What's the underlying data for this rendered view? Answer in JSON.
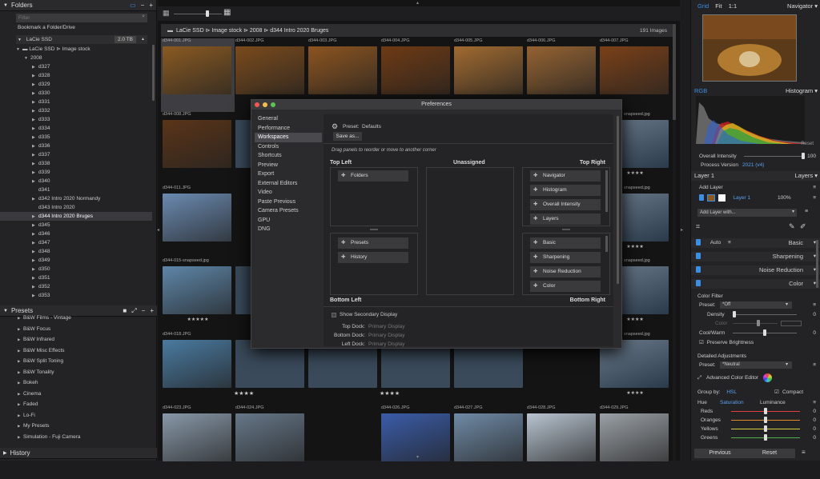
{
  "folders": {
    "title": "Folders",
    "filter_placeholder": "Filter",
    "bookmark_label": "Bookmark a Folder/Drive",
    "drive": {
      "name": "LaCie SSD",
      "size": "2.0 TB"
    },
    "tree": [
      {
        "label": "LaCie SSD ⊳ Image stock",
        "indent": 2,
        "arrow": "▼",
        "icon": true
      },
      {
        "label": "2008",
        "indent": 3,
        "arrow": "▼"
      },
      {
        "label": "d327",
        "indent": 4,
        "arrow": "▶"
      },
      {
        "label": "d328",
        "indent": 4,
        "arrow": "▶"
      },
      {
        "label": "d329",
        "indent": 4,
        "arrow": "▶"
      },
      {
        "label": "d330",
        "indent": 4,
        "arrow": "▶"
      },
      {
        "label": "d331",
        "indent": 4,
        "arrow": "▶"
      },
      {
        "label": "d332",
        "indent": 4,
        "arrow": "▶"
      },
      {
        "label": "d333",
        "indent": 4,
        "arrow": "▶"
      },
      {
        "label": "d334",
        "indent": 4,
        "arrow": "▶"
      },
      {
        "label": "d335",
        "indent": 4,
        "arrow": "▶"
      },
      {
        "label": "d336",
        "indent": 4,
        "arrow": "▶"
      },
      {
        "label": "d337",
        "indent": 4,
        "arrow": "▶"
      },
      {
        "label": "d338",
        "indent": 4,
        "arrow": "▶"
      },
      {
        "label": "d339",
        "indent": 4,
        "arrow": "▶"
      },
      {
        "label": "d340",
        "indent": 4,
        "arrow": "▶"
      },
      {
        "label": "d341",
        "indent": 4,
        "arrow": ""
      },
      {
        "label": "d342 Intro 2020 Normandy",
        "indent": 4,
        "arrow": "▶"
      },
      {
        "label": "d343 Intro 2020",
        "indent": 4,
        "arrow": ""
      },
      {
        "label": "d344 Intro 2020 Bruges",
        "indent": 4,
        "arrow": "▶",
        "selected": true
      },
      {
        "label": "d345",
        "indent": 4,
        "arrow": "▶"
      },
      {
        "label": "d346",
        "indent": 4,
        "arrow": "▶"
      },
      {
        "label": "d347",
        "indent": 4,
        "arrow": "▶"
      },
      {
        "label": "d348",
        "indent": 4,
        "arrow": "▶"
      },
      {
        "label": "d349",
        "indent": 4,
        "arrow": "▶"
      },
      {
        "label": "d350",
        "indent": 4,
        "arrow": "▶"
      },
      {
        "label": "d351",
        "indent": 4,
        "arrow": "▶"
      },
      {
        "label": "d352",
        "indent": 4,
        "arrow": "▶"
      },
      {
        "label": "d353",
        "indent": 4,
        "arrow": "▶"
      }
    ]
  },
  "presets": {
    "title": "Presets",
    "items": [
      "B&W Films - Vintage",
      "B&W Focus",
      "B&W Infrared",
      "B&W Misc Effects",
      "B&W Split Toning",
      "B&W Tonality",
      "Bokeh",
      "Cinema",
      "Faded",
      "Lo-Fi",
      "My Presets",
      "Simulation - Fuji Camera"
    ]
  },
  "history": {
    "title": "History"
  },
  "browser": {
    "breadcrumb": "LaCie SSD ⊳ Image stock ⊳ 2008 ⊳ d344 Intro 2020 Bruges",
    "count": "191 Images",
    "thumbnails": [
      {
        "name": "d344-001.JPG",
        "color": "#8a5a22",
        "stars": ""
      },
      {
        "name": "d344-002.JPG",
        "color": "#7a4a1c",
        "stars": ""
      },
      {
        "name": "d344-003.JPG",
        "color": "#8c5420",
        "stars": ""
      },
      {
        "name": "d344-004.JPG",
        "color": "#6e3a14",
        "stars": ""
      },
      {
        "name": "d344-005.JPG",
        "color": "#a06a30",
        "stars": ""
      },
      {
        "name": "d344-006.JPG",
        "color": "#946232",
        "stars": ""
      },
      {
        "name": "d344-007.JPG",
        "color": "#7a4018",
        "stars": ""
      },
      {
        "name": "d344-008.JPG",
        "color": "#5a3418",
        "stars": ""
      },
      {
        "name": "d344-011.JPG",
        "color": "#6a8ab0",
        "stars": ""
      },
      {
        "name": "d344-015-snapseed.jpg",
        "color": "#5e86a8",
        "stars": "★★★★★"
      },
      {
        "name": "d344-018.JPG",
        "color": "#4a7aa0",
        "stars": ""
      },
      {
        "name": "d344-023.JPG",
        "color": "#8898a8",
        "stars": ""
      },
      {
        "name": "d344-024.JPG",
        "color": "#667788",
        "stars": ""
      },
      {
        "name": "d344-026.JPG",
        "color": "#3a5ca8",
        "stars": ""
      },
      {
        "name": "d344-027.JPG",
        "color": "#6f8aa6",
        "stars": ""
      },
      {
        "name": "d344-028.JPG",
        "color": "#b8c4d0",
        "stars": ""
      },
      {
        "name": "d344-029.JPG",
        "color": "#9aa0a6",
        "stars": ""
      }
    ],
    "right_labels": [
      {
        "name": "snapseed.jpg",
        "stars": "★★★★"
      },
      {
        "name": "snapseed.jpg",
        "stars": "★★★★"
      }
    ],
    "mid_stars": [
      "★★★★",
      "★★★★"
    ]
  },
  "preferences": {
    "title": "Preferences",
    "nav": [
      "General",
      "Performance",
      "Workspaces",
      "Controls",
      "Shortcuts",
      "Preview",
      "Export",
      "External Editors",
      "Video",
      "Paste Previous",
      "Camera Presets",
      "GPU",
      "DNG"
    ],
    "selected_nav": 2,
    "preset_label": "Preset:",
    "preset_value": "Defaults",
    "save_as": "Save as...",
    "hint": "Drag panels to reorder or move to another corner",
    "top_left": "Top Left",
    "unassigned": "Unassigned",
    "top_right": "Top Right",
    "bottom_left": "Bottom Left",
    "bottom_right": "Bottom Right",
    "tl_panels": [
      "Folders"
    ],
    "tr_panels": [
      "Navigator",
      "Histogram",
      "Overall Intensity",
      "Layers"
    ],
    "bl_panels": [
      "Presets",
      "History"
    ],
    "br_panels": [
      "Basic",
      "Sharpening",
      "Noise Reduction",
      "Color"
    ],
    "show_secondary": "Show Secondary Display",
    "top_dock": "Top Dock:",
    "bottom_dock": "Bottom Dock:",
    "left_dock": "Left Dock:",
    "dock_value": "Primary Display"
  },
  "navigator": {
    "title": "Navigator",
    "grid": "Grid",
    "fit": "Fit",
    "one": "1:1"
  },
  "histogram": {
    "title": "Histogram",
    "mode": "RGB",
    "reset": "Reset"
  },
  "overall": {
    "label": "Overall Intensity",
    "value": "100",
    "process_label": "Process Version",
    "process_value": "2021 (v4)"
  },
  "layers": {
    "title": "Layers",
    "layer_label": "Layer 1",
    "add_layer": "Add Layer",
    "layer_name": "Layer 1",
    "opacity": "100%",
    "add_with": "Add Layer with..."
  },
  "adjust": {
    "auto": "Auto",
    "basic": "Basic",
    "sharpening": "Sharpening",
    "noise": "Noise Reduction",
    "color": "Color",
    "color_filter": "Color Filter",
    "preset_label": "Preset:",
    "preset_off": "*Off",
    "density": "Density",
    "density_val": "0",
    "color_lbl": "Color",
    "coolwarm": "Cool/Warm",
    "coolwarm_val": "0",
    "preserve": "Preserve Brightness",
    "detailed": "Detailed Adjustments",
    "preset_neutral": "*Neutral",
    "ace": "Advanced Color Editor",
    "group_by": "Group by:",
    "hsl": "HSL",
    "compact": "Compact",
    "hue": "Hue",
    "saturation": "Saturation",
    "luminance": "Luminance",
    "rows": [
      {
        "name": "Reds",
        "val": "0",
        "color": "#e04040"
      },
      {
        "name": "Oranges",
        "val": "0",
        "color": "#e08a30"
      },
      {
        "name": "Yellows",
        "val": "0",
        "color": "#d8d040"
      },
      {
        "name": "Greens",
        "val": "0",
        "color": "#50b050"
      }
    ],
    "previous": "Previous",
    "reset": "Reset"
  }
}
